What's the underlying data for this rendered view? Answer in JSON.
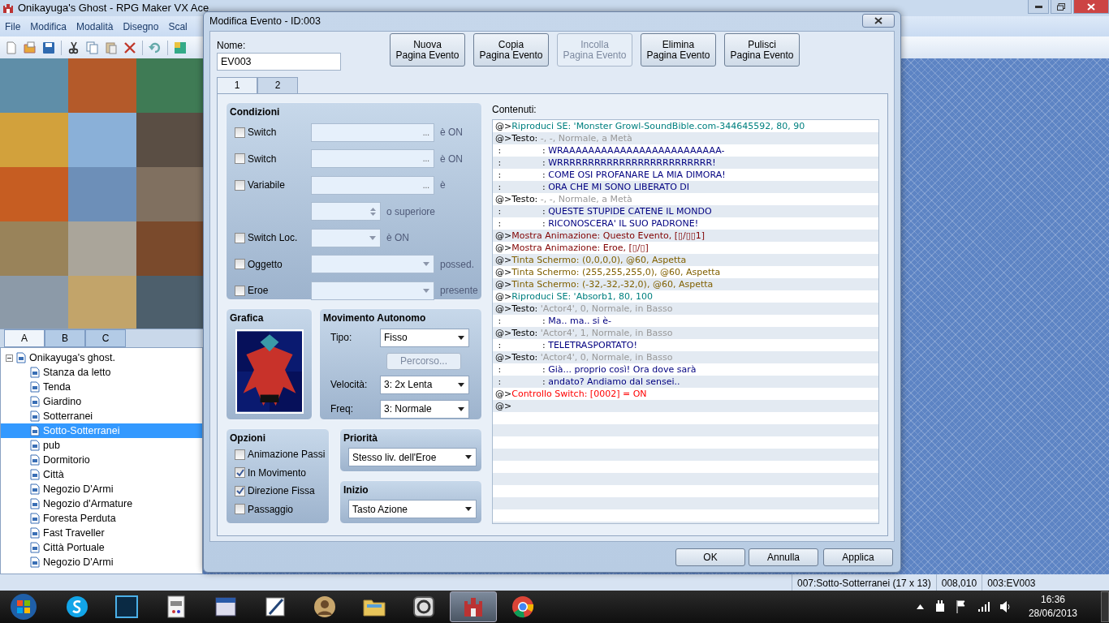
{
  "app": {
    "title": "Onikayuga's Ghost - RPG Maker VX Ace",
    "menu": [
      "File",
      "Modifica",
      "Modalità",
      "Disegno",
      "Scal"
    ],
    "tile_tabs": [
      {
        "label": "A",
        "selected": true
      },
      {
        "label": "B",
        "selected": false
      },
      {
        "label": "C",
        "selected": false
      }
    ],
    "map_tree": {
      "label": "Onikayuga's ghost.",
      "expanded": true,
      "children": [
        {
          "label": "Stanza da letto",
          "selected": false
        },
        {
          "label": "Tenda",
          "selected": false
        },
        {
          "label": "Giardino",
          "selected": false
        },
        {
          "label": "Sotterranei",
          "selected": false
        },
        {
          "label": "Sotto-Sotterranei",
          "selected": true
        },
        {
          "label": "pub",
          "selected": false
        },
        {
          "label": "Dormitorio",
          "selected": false
        },
        {
          "label": "Città",
          "selected": false
        },
        {
          "label": "Negozio D'Armi",
          "selected": false
        },
        {
          "label": "Negozio d'Armature",
          "selected": false
        },
        {
          "label": "Foresta Perduta",
          "selected": false
        },
        {
          "label": "Fast Traveller",
          "selected": false
        },
        {
          "label": "Città Portuale",
          "selected": false
        },
        {
          "label": "Negozio D'Armi",
          "selected": false
        }
      ]
    },
    "status_bar": [
      "007:Sotto-Sotterranei (17 x 13)",
      "008,010",
      "003:EV003"
    ]
  },
  "dialog": {
    "title": "Modifica Evento - ID:003",
    "name_label": "Nome:",
    "name_value": "EV003",
    "page_buttons": [
      {
        "lines": [
          "Nuova",
          "Pagina Evento"
        ],
        "disabled": false
      },
      {
        "lines": [
          "Copia",
          "Pagina Evento"
        ],
        "disabled": false
      },
      {
        "lines": [
          "Incolla",
          "Pagina Evento"
        ],
        "disabled": true
      },
      {
        "lines": [
          "Elimina",
          "Pagina Evento"
        ],
        "disabled": false
      },
      {
        "lines": [
          "Pulisci",
          "Pagina Evento"
        ],
        "disabled": false
      }
    ],
    "page_tabs": [
      {
        "label": "1",
        "selected": true
      },
      {
        "label": "2",
        "selected": false
      }
    ],
    "conditions": {
      "title": "Condizioni",
      "rows": [
        {
          "kind": "picker",
          "label": "Switch",
          "checked": false,
          "button": "...",
          "suffix": "è ON",
          "disabled": true
        },
        {
          "kind": "picker",
          "label": "Switch",
          "checked": false,
          "button": "...",
          "suffix": "è ON",
          "disabled": true
        },
        {
          "kind": "picker",
          "label": "Variabile",
          "checked": false,
          "button": "...",
          "suffix": "è",
          "disabled": true
        },
        {
          "kind": "spin",
          "suffix": "o superiore",
          "disabled": true
        },
        {
          "kind": "short_select",
          "label": "Switch Loc.",
          "checked": false,
          "suffix": "è ON",
          "disabled": true
        },
        {
          "kind": "select",
          "label": "Oggetto",
          "checked": false,
          "suffix": "possed.",
          "disabled": true
        },
        {
          "kind": "select",
          "label": "Eroe",
          "checked": false,
          "suffix": "presente",
          "disabled": true
        }
      ]
    },
    "graphic": {
      "title": "Grafica"
    },
    "movement": {
      "title": "Movimento Autonomo",
      "items": [
        {
          "kind": "select",
          "label": "Tipo:",
          "value": "Fisso"
        },
        {
          "kind": "button",
          "label": "Percorso...",
          "disabled": true
        },
        {
          "kind": "select",
          "label": "Velocità:",
          "value": "3: 2x Lenta"
        },
        {
          "kind": "select",
          "label": "Freq:",
          "value": "3: Normale"
        }
      ]
    },
    "options": {
      "title": "Opzioni",
      "items": [
        {
          "label": "Animazione Passi",
          "checked": false
        },
        {
          "label": "In Movimento",
          "checked": true
        },
        {
          "label": "Direzione Fissa",
          "checked": true
        },
        {
          "label": "Passaggio",
          "checked": false
        }
      ]
    },
    "priority": {
      "title": "Priorità",
      "value": "Stesso liv. dell'Eroe"
    },
    "trigger": {
      "title": "Inizio",
      "value": "Tasto Azione"
    },
    "contents": {
      "title": "Contenuti:",
      "lines": [
        {
          "kind": "sound",
          "prefix": "@>",
          "head": "Riproduci SE:",
          "args": "'Monster Growl-SoundBible.com-344645592, 80, 90"
        },
        {
          "kind": "text",
          "prefix": "@>",
          "head": "Testo:",
          "args": "-, -, Normale, a Metà"
        },
        {
          "kind": "text_line",
          "prefix": ":",
          "marker": ":",
          "args": "WRAAAAAAAAAAAAAAAAAAAAAAAAA-"
        },
        {
          "kind": "text_line",
          "prefix": ":",
          "marker": ":",
          "args": "WRRRRRRRRRRRRRRRRRRRRRRRRR!"
        },
        {
          "kind": "text_line",
          "prefix": ":",
          "marker": ":",
          "args": "COME OSI PROFANARE LA MIA DIMORA!"
        },
        {
          "kind": "text_line",
          "prefix": ":",
          "marker": ":",
          "args": "ORA CHE MI SONO LIBERATO DI"
        },
        {
          "kind": "text",
          "prefix": "@>",
          "head": "Testo:",
          "args": "-, -, Normale, a Metà"
        },
        {
          "kind": "text_line",
          "prefix": ":",
          "marker": ":",
          "args": "QUESTE STUPIDE CATENE IL MONDO"
        },
        {
          "kind": "text_line",
          "prefix": ":",
          "marker": ":",
          "args": "RICONOSCERA' IL SUO PADRONE!"
        },
        {
          "kind": "animation",
          "prefix": "@>",
          "head": "Mostra Animazione:",
          "args": "Questo Evento, [▯/▯▯1]"
        },
        {
          "kind": "animation",
          "prefix": "@>",
          "head": "Mostra Animazione:",
          "args": "Eroe, [▯/▯]"
        },
        {
          "kind": "tint",
          "prefix": "@>",
          "head": "Tinta Schermo:",
          "args": "(0,0,0,0), @60, Aspetta"
        },
        {
          "kind": "tint",
          "prefix": "@>",
          "head": "Tinta Schermo:",
          "args": "(255,255,255,0), @60, Aspetta"
        },
        {
          "kind": "tint",
          "prefix": "@>",
          "head": "Tinta Schermo:",
          "args": "(-32,-32,-32,0), @60, Aspetta"
        },
        {
          "kind": "sound",
          "prefix": "@>",
          "head": "Riproduci SE:",
          "args": "'Absorb1, 80, 100"
        },
        {
          "kind": "text",
          "prefix": "@>",
          "head": "Testo:",
          "args": "'Actor4', 0, Normale, in Basso"
        },
        {
          "kind": "text_line",
          "prefix": ":",
          "marker": ":",
          "args": "Ma.. ma.. si è-"
        },
        {
          "kind": "text",
          "prefix": "@>",
          "head": "Testo:",
          "args": "'Actor4', 1, Normale, in Basso"
        },
        {
          "kind": "text_line",
          "prefix": ":",
          "marker": ":",
          "args": "TELETRASPORTATO!"
        },
        {
          "kind": "text",
          "prefix": "@>",
          "head": "Testo:",
          "args": "'Actor4', 0, Normale, in Basso"
        },
        {
          "kind": "text_line",
          "prefix": ":",
          "marker": ":",
          "args": "Già... proprio così! Ora dove sarà"
        },
        {
          "kind": "text_line",
          "prefix": ":",
          "marker": ":",
          "args": "andato? Andiamo dal sensei.."
        },
        {
          "kind": "switch",
          "prefix": "@>",
          "head": "Controllo Switch:",
          "args": "[0002] = ON"
        },
        {
          "kind": "empty",
          "prefix": "@>"
        }
      ]
    },
    "buttons": [
      "OK",
      "Annulla",
      "Applica"
    ]
  },
  "taskbar": {
    "apps": [
      {
        "kind": "chat",
        "selected": false
      },
      {
        "kind": "image_editor",
        "selected": false
      },
      {
        "kind": "document",
        "selected": false
      },
      {
        "kind": "window",
        "selected": false
      },
      {
        "kind": "pen",
        "selected": false
      },
      {
        "kind": "avatar",
        "selected": false
      },
      {
        "kind": "folder",
        "selected": false
      },
      {
        "kind": "g_app",
        "selected": false
      },
      {
        "kind": "castle",
        "selected": true
      },
      {
        "kind": "browser",
        "selected": false
      }
    ],
    "time": "16:36",
    "date": "28/06/2013"
  }
}
